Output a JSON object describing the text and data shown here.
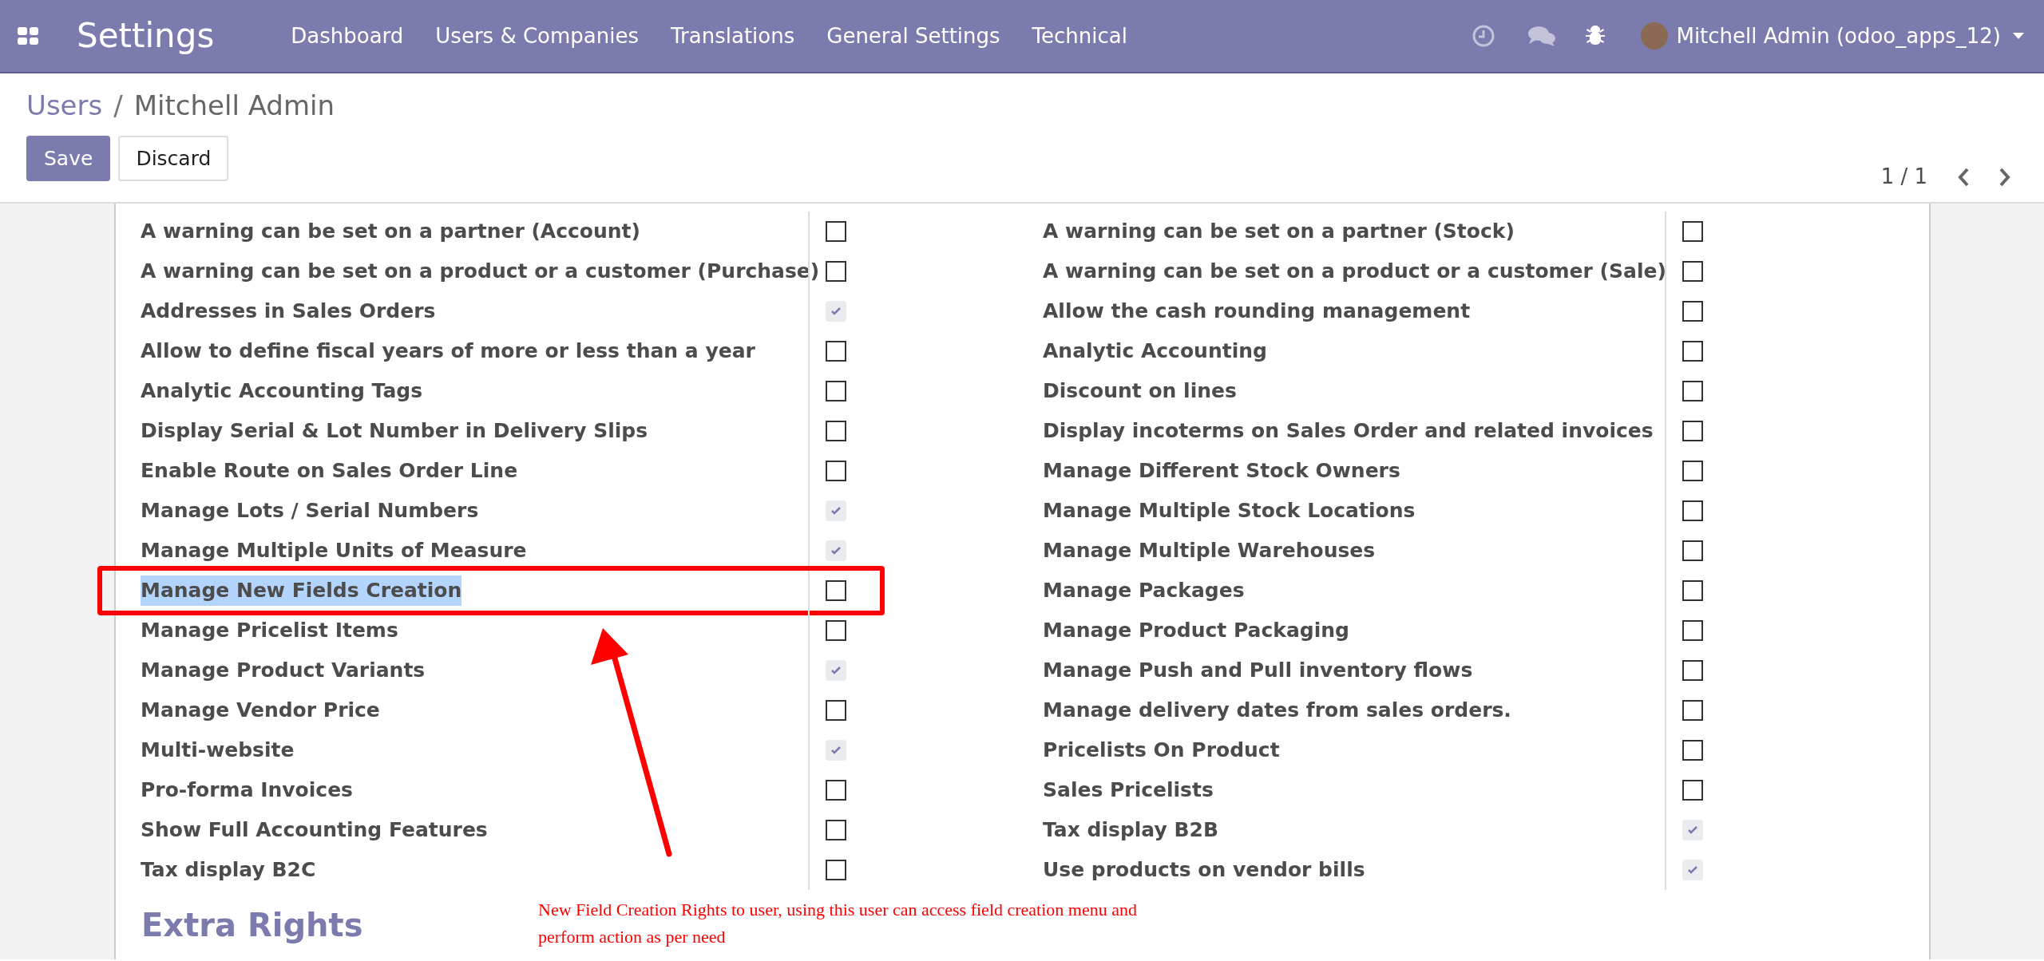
{
  "navbar": {
    "app_title": "Settings",
    "menu": [
      "Dashboard",
      "Users & Companies",
      "Translations",
      "General Settings",
      "Technical"
    ],
    "user": "Mitchell Admin (odoo_apps_12)"
  },
  "breadcrumb": {
    "parent": "Users",
    "separator": "/",
    "current": "Mitchell Admin"
  },
  "buttons": [
    {
      "label": "Save",
      "kind": "primary"
    },
    {
      "label": "Discard",
      "kind": "secondary"
    }
  ],
  "pager": "1 / 1",
  "left_rights": [
    {
      "label": "A warning can be set on a partner (Account)",
      "checked": false
    },
    {
      "label": "A warning can be set on a product or a customer (Purchase)",
      "checked": false
    },
    {
      "label": "Addresses in Sales Orders",
      "checked": true
    },
    {
      "label": "Allow to define fiscal years of more or less than a year",
      "checked": false
    },
    {
      "label": "Analytic Accounting Tags",
      "checked": false
    },
    {
      "label": "Display Serial & Lot Number in Delivery Slips",
      "checked": false
    },
    {
      "label": "Enable Route on Sales Order Line",
      "checked": false
    },
    {
      "label": "Manage Lots / Serial Numbers",
      "checked": true
    },
    {
      "label": "Manage Multiple Units of Measure",
      "checked": true
    },
    {
      "label": "Manage New Fields Creation",
      "checked": false,
      "text_selected": true,
      "annotated": true
    },
    {
      "label": "Manage Pricelist Items",
      "checked": false
    },
    {
      "label": "Manage Product Variants",
      "checked": true
    },
    {
      "label": "Manage Vendor Price",
      "checked": false
    },
    {
      "label": "Multi-website",
      "checked": true
    },
    {
      "label": "Pro-forma Invoices",
      "checked": false
    },
    {
      "label": "Show Full Accounting Features",
      "checked": false
    },
    {
      "label": "Tax display B2C",
      "checked": false
    }
  ],
  "right_rights": [
    {
      "label": "A warning can be set on a partner (Stock)",
      "checked": false
    },
    {
      "label": "A warning can be set on a product or a customer (Sale)",
      "checked": false
    },
    {
      "label": "Allow the cash rounding management",
      "checked": false
    },
    {
      "label": "Analytic Accounting",
      "checked": false
    },
    {
      "label": "Discount on lines",
      "checked": false
    },
    {
      "label": "Display incoterms on Sales Order and related invoices",
      "checked": false
    },
    {
      "label": "Manage Different Stock Owners",
      "checked": false
    },
    {
      "label": "Manage Multiple Stock Locations",
      "checked": false
    },
    {
      "label": "Manage Multiple Warehouses",
      "checked": false
    },
    {
      "label": "Manage Packages",
      "checked": false
    },
    {
      "label": "Manage Product Packaging",
      "checked": false
    },
    {
      "label": "Manage Push and Pull inventory flows",
      "checked": false
    },
    {
      "label": "Manage delivery dates from sales orders.",
      "checked": false
    },
    {
      "label": "Pricelists On Product",
      "checked": false
    },
    {
      "label": "Sales Pricelists",
      "checked": false
    },
    {
      "label": "Tax display B2B",
      "checked": true
    },
    {
      "label": "Use products on vendor bills",
      "checked": true
    }
  ],
  "section_title": "Extra Rights",
  "annotation_note": "New Field Creation Rights to user, using this user can access field creation menu and perform action as per need"
}
